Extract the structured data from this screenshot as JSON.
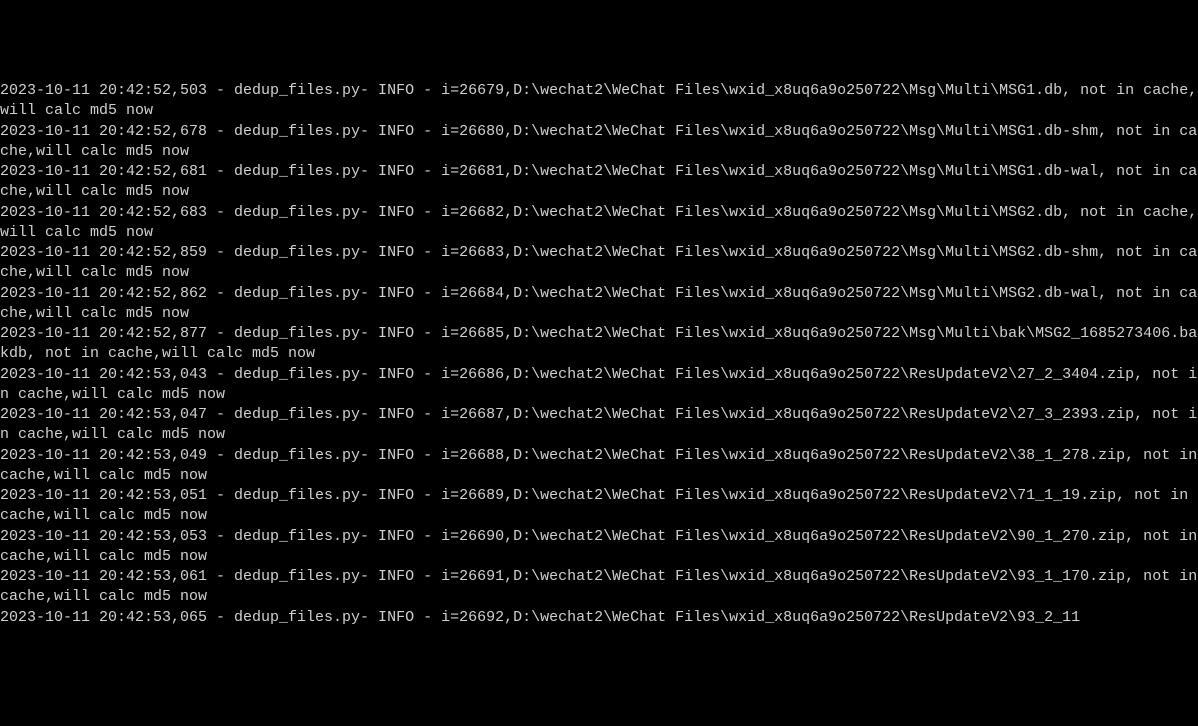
{
  "terminal": {
    "lines": [
      "2023-10-11 20:42:52,503 - dedup_files.py- INFO - i=26679,D:\\wechat2\\WeChat Files\\wxid_x8uq6a9o250722\\Msg\\Multi\\MSG1.db, not in cache,will calc md5 now",
      "2023-10-11 20:42:52,678 - dedup_files.py- INFO - i=26680,D:\\wechat2\\WeChat Files\\wxid_x8uq6a9o250722\\Msg\\Multi\\MSG1.db-shm, not in cache,will calc md5 now",
      "2023-10-11 20:42:52,681 - dedup_files.py- INFO - i=26681,D:\\wechat2\\WeChat Files\\wxid_x8uq6a9o250722\\Msg\\Multi\\MSG1.db-wal, not in cache,will calc md5 now",
      "2023-10-11 20:42:52,683 - dedup_files.py- INFO - i=26682,D:\\wechat2\\WeChat Files\\wxid_x8uq6a9o250722\\Msg\\Multi\\MSG2.db, not in cache,will calc md5 now",
      "2023-10-11 20:42:52,859 - dedup_files.py- INFO - i=26683,D:\\wechat2\\WeChat Files\\wxid_x8uq6a9o250722\\Msg\\Multi\\MSG2.db-shm, not in cache,will calc md5 now",
      "2023-10-11 20:42:52,862 - dedup_files.py- INFO - i=26684,D:\\wechat2\\WeChat Files\\wxid_x8uq6a9o250722\\Msg\\Multi\\MSG2.db-wal, not in cache,will calc md5 now",
      "2023-10-11 20:42:52,877 - dedup_files.py- INFO - i=26685,D:\\wechat2\\WeChat Files\\wxid_x8uq6a9o250722\\Msg\\Multi\\bak\\MSG2_1685273406.bakdb, not in cache,will calc md5 now",
      "2023-10-11 20:42:53,043 - dedup_files.py- INFO - i=26686,D:\\wechat2\\WeChat Files\\wxid_x8uq6a9o250722\\ResUpdateV2\\27_2_3404.zip, not in cache,will calc md5 now",
      "2023-10-11 20:42:53,047 - dedup_files.py- INFO - i=26687,D:\\wechat2\\WeChat Files\\wxid_x8uq6a9o250722\\ResUpdateV2\\27_3_2393.zip, not in cache,will calc md5 now",
      "2023-10-11 20:42:53,049 - dedup_files.py- INFO - i=26688,D:\\wechat2\\WeChat Files\\wxid_x8uq6a9o250722\\ResUpdateV2\\38_1_278.zip, not in cache,will calc md5 now",
      "2023-10-11 20:42:53,051 - dedup_files.py- INFO - i=26689,D:\\wechat2\\WeChat Files\\wxid_x8uq6a9o250722\\ResUpdateV2\\71_1_19.zip, not in cache,will calc md5 now",
      "2023-10-11 20:42:53,053 - dedup_files.py- INFO - i=26690,D:\\wechat2\\WeChat Files\\wxid_x8uq6a9o250722\\ResUpdateV2\\90_1_270.zip, not in cache,will calc md5 now",
      "2023-10-11 20:42:53,061 - dedup_files.py- INFO - i=26691,D:\\wechat2\\WeChat Files\\wxid_x8uq6a9o250722\\ResUpdateV2\\93_1_170.zip, not in cache,will calc md5 now",
      "2023-10-11 20:42:53,065 - dedup_files.py- INFO - i=26692,D:\\wechat2\\WeChat Files\\wxid_x8uq6a9o250722\\ResUpdateV2\\93_2_11"
    ]
  }
}
